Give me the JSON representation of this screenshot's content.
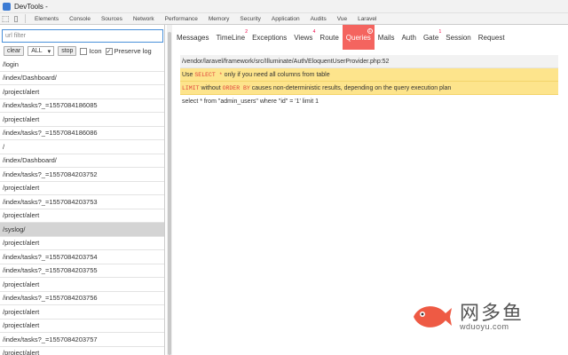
{
  "window": {
    "title": "DevTools -"
  },
  "devtools_tabs": [
    "Elements",
    "Console",
    "Sources",
    "Network",
    "Performance",
    "Memory",
    "Security",
    "Application",
    "Audits",
    "Vue",
    "Laravel"
  ],
  "filter": {
    "placeholder": "url filter"
  },
  "controls": {
    "clear": "clear",
    "select_value": "ALL",
    "stop": "stop",
    "icon_label": "Icon",
    "preserve_label": "Preserve log",
    "icon_checked": false,
    "preserve_checked": true
  },
  "requests": [
    "/login",
    "/index/Dashboard/",
    "/project/alert",
    "/index/tasks?_=1557084186085",
    "/project/alert",
    "/index/tasks?_=1557084186086",
    "/",
    "/index/Dashboard/",
    "/index/tasks?_=1557084203752",
    "/project/alert",
    "/index/tasks?_=1557084203753",
    "/project/alert",
    "/syslog/",
    "/project/alert",
    "/index/tasks?_=1557084203754",
    "/index/tasks?_=1557084203755",
    "/project/alert",
    "/index/tasks?_=1557084203756",
    "/project/alert",
    "/project/alert",
    "/index/tasks?_=1557084203757",
    "/project/alert"
  ],
  "selected_request_index": 12,
  "debugbar_tabs": [
    {
      "label": "Messages",
      "badge": ""
    },
    {
      "label": "TimeLine",
      "badge": "2"
    },
    {
      "label": "Exceptions",
      "badge": ""
    },
    {
      "label": "Views",
      "badge": "4"
    },
    {
      "label": "Route",
      "badge": ""
    },
    {
      "label": "Queries",
      "badge": "1",
      "active": true
    },
    {
      "label": "Mails",
      "badge": ""
    },
    {
      "label": "Auth",
      "badge": ""
    },
    {
      "label": "Gate",
      "badge": "1"
    },
    {
      "label": "Session",
      "badge": ""
    },
    {
      "label": "Request",
      "badge": ""
    }
  ],
  "query": {
    "path": "/vendor/laravel/framework/src/Illuminate/Auth/EloquentUserProvider.php:52",
    "hint1": {
      "pre": "Use ",
      "kw": "SELECT *",
      "post": " only if you need all columns from table"
    },
    "hint2": {
      "kw1": "LIMIT",
      "mid1": " without ",
      "kw2": "ORDER BY",
      "post": " causes non-deterministic results, depending on the query execution plan"
    },
    "sql": "select * from \"admin_users\" where \"id\" = '1' limit 1"
  },
  "watermark": {
    "text": "网多鱼",
    "url": "wduoyu.com"
  },
  "colors": {
    "active_tab": "#f4645f",
    "warning": "#fde48c",
    "keyword": "#e0433b",
    "selected_row": "#d4d4d4"
  }
}
